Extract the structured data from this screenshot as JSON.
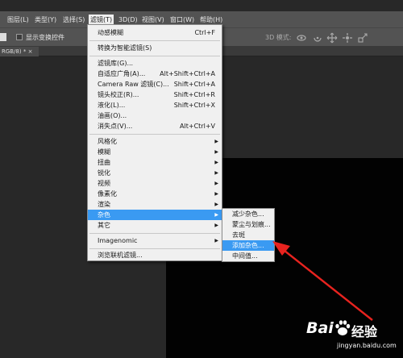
{
  "menubar": {
    "items": [
      {
        "label": "图层(L)"
      },
      {
        "label": "类型(Y)"
      },
      {
        "label": "选择(S)"
      },
      {
        "label": "滤镜(T)"
      },
      {
        "label": "3D(D)"
      },
      {
        "label": "视图(V)"
      },
      {
        "label": "窗口(W)"
      },
      {
        "label": "帮助(H)"
      }
    ]
  },
  "optionsbar": {
    "transform_controls_label": "显示变换控件",
    "mode_3d_label": "3D 模式:"
  },
  "document_tab": {
    "label": "RGB/8) * ×"
  },
  "filter_menu": {
    "items": [
      {
        "label": "动感模糊",
        "shortcut": "Ctrl+F"
      },
      {
        "label": "转换为智能滤镜(S)",
        "shortcut": ""
      },
      {
        "label": "滤镜库(G)...",
        "shortcut": ""
      },
      {
        "label": "自适应广角(A)...",
        "shortcut": "Alt+Shift+Ctrl+A"
      },
      {
        "label": "Camera Raw 滤镜(C)...",
        "shortcut": "Shift+Ctrl+A"
      },
      {
        "label": "镜头校正(R)...",
        "shortcut": "Shift+Ctrl+R"
      },
      {
        "label": "液化(L)...",
        "shortcut": "Shift+Ctrl+X"
      },
      {
        "label": "油画(O)...",
        "shortcut": ""
      },
      {
        "label": "消失点(V)...",
        "shortcut": "Alt+Ctrl+V"
      },
      {
        "label": "风格化",
        "shortcut": ""
      },
      {
        "label": "模糊",
        "shortcut": ""
      },
      {
        "label": "扭曲",
        "shortcut": ""
      },
      {
        "label": "锐化",
        "shortcut": ""
      },
      {
        "label": "视频",
        "shortcut": ""
      },
      {
        "label": "像素化",
        "shortcut": ""
      },
      {
        "label": "渲染",
        "shortcut": ""
      },
      {
        "label": "杂色",
        "shortcut": ""
      },
      {
        "label": "其它",
        "shortcut": ""
      },
      {
        "label": "Imagenomic",
        "shortcut": ""
      },
      {
        "label": "浏览联机滤镜...",
        "shortcut": ""
      }
    ]
  },
  "noise_submenu": {
    "items": [
      {
        "label": "减少杂色..."
      },
      {
        "label": "蒙尘与划痕..."
      },
      {
        "label": "去斑"
      },
      {
        "label": "添加杂色..."
      },
      {
        "label": "中间值..."
      }
    ]
  },
  "watermark": {
    "brand": "Bai",
    "brand_suffix": "经验",
    "url": "jingyan.baidu.com"
  },
  "colors": {
    "highlight": "#3a9af2",
    "arrow": "#e8231f"
  }
}
